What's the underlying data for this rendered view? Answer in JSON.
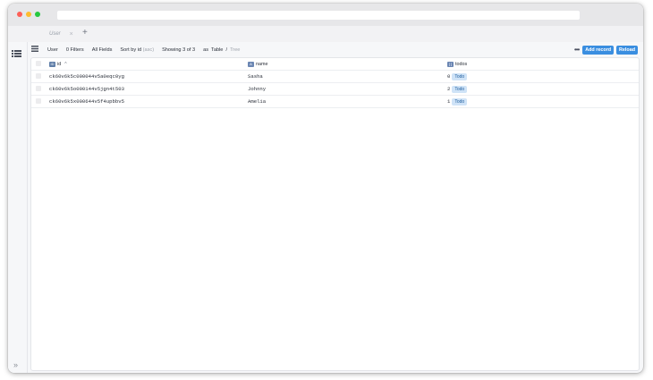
{
  "browser": {
    "tab_title": "User",
    "tab_close": "×",
    "new_tab": "+"
  },
  "toolbar": {
    "model": "User",
    "filters": "0 Filters",
    "fields": "All Fields",
    "sort_prefix": "Sort by",
    "sort_field": "id",
    "sort_dir": "(asc)",
    "showing": "Showing 3 of 3",
    "as_label": "as",
    "view_table": "Table",
    "view_sep": "/",
    "view_tree": "Tree",
    "more": "•••",
    "add_record": "Add record",
    "reload": "Reload"
  },
  "table": {
    "columns": [
      {
        "label": "id",
        "type_badge": "ID",
        "sort": "^"
      },
      {
        "label": "name",
        "type_badge": "A"
      },
      {
        "label": "todos",
        "type_badge": "[ ]"
      }
    ],
    "rows": [
      {
        "id": "ck60v6k5c000044v5a0eqc0yg",
        "name": "Sasha",
        "todos_count": "0",
        "todos_tag": "Todo"
      },
      {
        "id": "ck60v6k5o000144v5jgn4t503",
        "name": "Johnny",
        "todos_count": "2",
        "todos_tag": "Todo"
      },
      {
        "id": "ck60v6k5x000644v5f4upbbv5",
        "name": "Amelia",
        "todos_count": "1",
        "todos_tag": "Todo"
      }
    ]
  },
  "sidebar": {
    "menu_icon": "list-menu-icon",
    "expand": "»"
  },
  "colors": {
    "accent": "#3a8ee0",
    "tag_bg": "#cfe3f7",
    "tag_text": "#1f5e9e"
  }
}
